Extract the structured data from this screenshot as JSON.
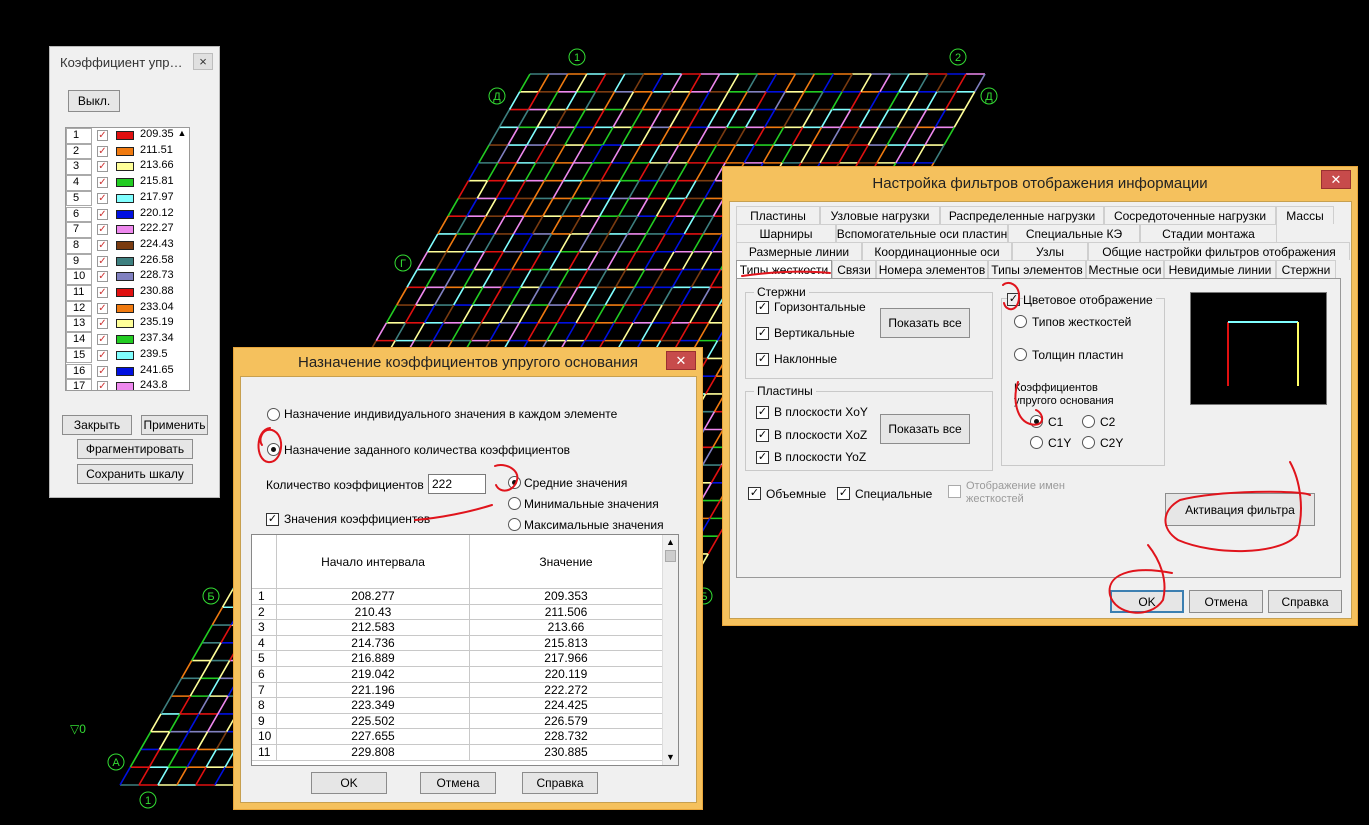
{
  "colors": {
    "window_frame": "#f5c15d",
    "annotation": "#e0141c",
    "scale": [
      "#e01010",
      "#f07a10",
      "#ffff99",
      "#22cc22",
      "#80ffff",
      "#0010e0",
      "#ee88ee",
      "#7a3b10",
      "#3d7f7f",
      "#8080c0",
      "#e01010",
      "#f07a10",
      "#ffff99",
      "#22cc22",
      "#80ffff",
      "#0010e0",
      "#ee88ee"
    ]
  },
  "drawing": {
    "axis_labels": [
      "1",
      "2",
      "Д",
      "Д",
      "Г",
      "Б",
      "Б",
      "А",
      "1"
    ],
    "level_mark": "▽0"
  },
  "scale_panel": {
    "title": "Коэффициент упр…",
    "off_button": "Выкл.",
    "rows": [
      {
        "n": "1",
        "v": "209.35"
      },
      {
        "n": "2",
        "v": "211.51"
      },
      {
        "n": "3",
        "v": "213.66"
      },
      {
        "n": "4",
        "v": "215.81"
      },
      {
        "n": "5",
        "v": "217.97"
      },
      {
        "n": "6",
        "v": "220.12"
      },
      {
        "n": "7",
        "v": "222.27"
      },
      {
        "n": "8",
        "v": "224.43"
      },
      {
        "n": "9",
        "v": "226.58"
      },
      {
        "n": "10",
        "v": "228.73"
      },
      {
        "n": "11",
        "v": "230.88"
      },
      {
        "n": "12",
        "v": "233.04"
      },
      {
        "n": "13",
        "v": "235.19"
      },
      {
        "n": "14",
        "v": "237.34"
      },
      {
        "n": "15",
        "v": "239.5"
      },
      {
        "n": "16",
        "v": "241.65"
      },
      {
        "n": "17",
        "v": "243.8"
      }
    ],
    "close_button": "Закрыть",
    "apply_button": "Применить",
    "fragment_button": "Фрагментировать",
    "save_button": "Сохранить шкалу"
  },
  "coef_dialog": {
    "title": "Назначение коэффициентов упругого основания",
    "radio_individual": "Назначение индивидуального значения в каждом элементе",
    "radio_count": "Назначение заданного количества коэффициентов",
    "count_label": "Количество коэффициентов",
    "count_value": "222",
    "radio_mean": "Средние значения",
    "radio_min": "Минимальные значения",
    "radio_max": "Максимальные значения",
    "values_checkbox": "Значения коэффициентов",
    "table": {
      "headers": [
        "Начало интервала",
        "Значение"
      ],
      "rows": [
        {
          "n": "1",
          "start": "208.277",
          "value": "209.353"
        },
        {
          "n": "2",
          "start": "210.43",
          "value": "211.506"
        },
        {
          "n": "3",
          "start": "212.583",
          "value": "213.66"
        },
        {
          "n": "4",
          "start": "214.736",
          "value": "215.813"
        },
        {
          "n": "5",
          "start": "216.889",
          "value": "217.966"
        },
        {
          "n": "6",
          "start": "219.042",
          "value": "220.119"
        },
        {
          "n": "7",
          "start": "221.196",
          "value": "222.272"
        },
        {
          "n": "8",
          "start": "223.349",
          "value": "224.425"
        },
        {
          "n": "9",
          "start": "225.502",
          "value": "226.579"
        },
        {
          "n": "10",
          "start": "227.655",
          "value": "228.732"
        },
        {
          "n": "11",
          "start": "229.808",
          "value": "230.885"
        }
      ]
    },
    "ok": "OK",
    "cancel": "Отмена",
    "help": "Справка"
  },
  "filter_dialog": {
    "title": "Настройка фильтров отображения информации",
    "tabs_row1": [
      "Пластины",
      "Узловые нагрузки",
      "Распределенные нагрузки",
      "Сосредоточенные нагрузки",
      "Массы"
    ],
    "tabs_row2": [
      "Шарниры",
      "Вспомогательные оси пластин",
      "Специальные КЭ",
      "Стадии монтажа"
    ],
    "tabs_row3": [
      "Размерные линии",
      "Координационные оси",
      "Узлы",
      "Общие настройки фильтров отображения"
    ],
    "tabs_row4": [
      "Типы жесткости",
      "Связи",
      "Номера элементов",
      "Типы элементов",
      "Местные оси",
      "Невидимые линии",
      "Стержни"
    ],
    "rods_group": "Стержни",
    "rods_horizontal": "Горизонтальные",
    "rods_vertical": "Вертикальные",
    "rods_inclined": "Наклонные",
    "show_all_1": "Показать все",
    "plates_group": "Пластины",
    "plates_xoy": "В плоскости XoY",
    "plates_xoz": "В плоскости XoZ",
    "plates_yoz": "В плоскости YoZ",
    "show_all_2": "Показать все",
    "volumetric": "Объемные",
    "special": "Специальные",
    "show_names": "Отображение имен жесткостей",
    "color_display": "Цветовое отображение",
    "types_stiffness": "Типов жесткостей",
    "plate_thickness": "Толщин пластин",
    "elastic_coef": "Коэффициентов упругого основания",
    "c1": "C1",
    "c2": "C2",
    "c1y": "C1Y",
    "c2y": "C2Y",
    "activate_filter": "Активация фильтра",
    "ok": "OK",
    "cancel": "Отмена",
    "help": "Справка"
  }
}
